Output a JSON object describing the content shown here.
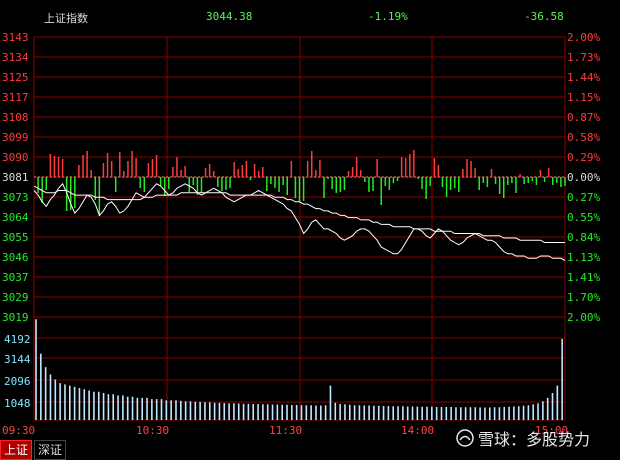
{
  "header": {
    "name": "上证指数",
    "price": "3044.38",
    "pct": "-1.19%",
    "change": "-36.58"
  },
  "colors": {
    "up": "#ff3b3b",
    "down": "#22ee22",
    "grid": "#8b0000",
    "price_line": "#ffffff",
    "volume_bar": "#bfe9ff",
    "volume_axis": "#7fe7ff"
  },
  "chart_data": [
    {
      "type": "line",
      "series": [
        {
          "name": "",
          "values": [
            3075,
            3073,
            3070,
            3068,
            3071,
            3073,
            3076,
            3078,
            3074,
            3069,
            3065,
            3067,
            3070,
            3073,
            3072,
            3069,
            3064,
            3066,
            3069,
            3070,
            3068,
            3065,
            3066,
            3068,
            3071,
            3074,
            3073,
            3072,
            3074,
            3076,
            3078,
            3077,
            3075,
            3073,
            3074,
            3076,
            3077,
            3078,
            3077,
            3076,
            3074,
            3073,
            3074,
            3075,
            3076,
            3075,
            3074,
            3072,
            3071,
            3070,
            3071,
            3072,
            3073,
            3073,
            3074,
            3075,
            3074,
            3073,
            3072,
            3071,
            3070,
            3069,
            3067,
            3066,
            3063,
            3060,
            3056,
            3058,
            3061,
            3062,
            3060,
            3058,
            3058,
            3057,
            3056,
            3054,
            3053,
            3054,
            3055,
            3057,
            3058,
            3058,
            3057,
            3055,
            3053,
            3050,
            3049,
            3048,
            3047,
            3047,
            3049,
            3052,
            3055,
            3058,
            3058,
            3057,
            3055,
            3054,
            3056,
            3058,
            3057,
            3055,
            3053,
            3052,
            3051,
            3052,
            3054,
            3055,
            3056,
            3055,
            3054,
            3053,
            3053,
            3052,
            3050,
            3048,
            3047,
            3047,
            3046,
            3046,
            3046,
            3045,
            3045,
            3045,
            3046,
            3046,
            3046,
            3045,
            3045,
            3045,
            3044
          ]
        },
        {
          "name": "",
          "values": [
            3077,
            3076,
            3075,
            3074,
            3074,
            3074,
            3075,
            3075,
            3075,
            3074,
            3073,
            3073,
            3073,
            3073,
            3073,
            3072,
            3072,
            3072,
            3071,
            3071,
            3071,
            3071,
            3071,
            3071,
            3071,
            3071,
            3071,
            3072,
            3072,
            3072,
            3073,
            3073,
            3073,
            3073,
            3073,
            3073,
            3074,
            3074,
            3074,
            3074,
            3074,
            3074,
            3074,
            3074,
            3074,
            3074,
            3074,
            3074,
            3073,
            3073,
            3073,
            3073,
            3073,
            3073,
            3073,
            3073,
            3073,
            3073,
            3073,
            3072,
            3072,
            3072,
            3071,
            3071,
            3070,
            3070,
            3069,
            3069,
            3068,
            3067,
            3067,
            3066,
            3066,
            3065,
            3065,
            3064,
            3064,
            3063,
            3063,
            3063,
            3062,
            3062,
            3062,
            3061,
            3061,
            3060,
            3060,
            3060,
            3059,
            3059,
            3059,
            3059,
            3059,
            3058,
            3058,
            3058,
            3058,
            3058,
            3057,
            3057,
            3057,
            3057,
            3057,
            3056,
            3056,
            3056,
            3056,
            3056,
            3056,
            3056,
            3055,
            3055,
            3055,
            3055,
            3055,
            3054,
            3054,
            3054,
            3054,
            3053,
            3053,
            3053,
            3053,
            3053,
            3053,
            3052,
            3052,
            3052,
            3052,
            3052,
            3052
          ]
        }
      ],
      "x_ticks": [
        "09:30",
        "10:30",
        "11:30",
        "14:00",
        "15:00"
      ],
      "y_ticks": [
        "3143",
        "3134",
        "3125",
        "3117",
        "3108",
        "3099",
        "3090",
        "3081",
        "3073",
        "3064",
        "3055",
        "3046",
        "3037",
        "3029",
        "3019"
      ],
      "y_pct_ticks": [
        "2.00%",
        "1.73%",
        "1.44%",
        "1.15%",
        "0.87%",
        "0.58%",
        "0.29%",
        "0.00%",
        "0.27%",
        "0.55%",
        "0.84%",
        "1.13%",
        "1.41%",
        "1.70%",
        "2.00%"
      ],
      "ylim": [
        3019,
        3143
      ],
      "pre_close": 3081,
      "grid": true
    },
    {
      "type": "bar",
      "name": "",
      "values": [
        4100,
        2700,
        2150,
        1850,
        1650,
        1500,
        1450,
        1400,
        1350,
        1300,
        1250,
        1200,
        1150,
        1150,
        1100,
        1050,
        1050,
        1000,
        1000,
        950,
        950,
        900,
        900,
        900,
        850,
        850,
        850,
        800,
        800,
        800,
        780,
        760,
        760,
        740,
        740,
        720,
        720,
        700,
        700,
        690,
        680,
        680,
        670,
        660,
        660,
        650,
        650,
        640,
        640,
        630,
        630,
        620,
        620,
        610,
        610,
        600,
        600,
        600,
        590,
        590,
        600,
        1400,
        700,
        650,
        640,
        620,
        600,
        600,
        590,
        590,
        580,
        580,
        570,
        570,
        560,
        560,
        560,
        550,
        550,
        550,
        540,
        540,
        540,
        530,
        530,
        530,
        530,
        520,
        520,
        520,
        520,
        520,
        510,
        510,
        510,
        520,
        520,
        530,
        540,
        550,
        560,
        580,
        600,
        640,
        680,
        760,
        900,
        1100,
        1400,
        3300
      ],
      "y_ticks": [
        "4192",
        "3144",
        "2096",
        "1048"
      ],
      "ylim": [
        0,
        4192
      ]
    }
  ],
  "tabs": [
    "上证",
    "深证"
  ],
  "watermark": "雪球：多股势力"
}
